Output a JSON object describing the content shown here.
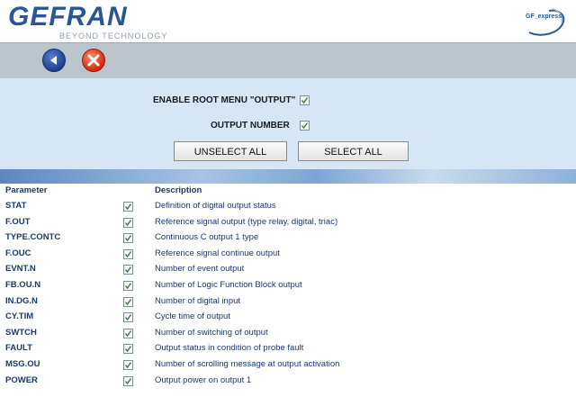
{
  "header": {
    "logo_text": "GEFRAN",
    "tagline": "BEYOND TECHNOLOGY",
    "right_logo_text": "GF_express"
  },
  "toolbar": {
    "back_icon": "back-arrow-icon",
    "close_icon": "close-icon"
  },
  "options": {
    "enable_root_label": "ENABLE ROOT MENU \"OUTPUT\"",
    "enable_root_checked": true,
    "output_number_label": "OUTPUT NUMBER",
    "output_number_checked": true
  },
  "buttons": {
    "unselect_all": "UNSELECT ALL",
    "select_all": "SELECT ALL"
  },
  "table": {
    "headers": {
      "parameter": "Parameter",
      "description": "Description"
    },
    "rows": [
      {
        "param": "STAT",
        "desc": "Definition of digital output status",
        "checked": true
      },
      {
        "param": "F.OUT",
        "desc": "Reference signal output (type relay, digital, triac)",
        "checked": true
      },
      {
        "param": "TYPE.CONTC",
        "desc": "Continuous C output 1 type",
        "checked": true
      },
      {
        "param": "F.OUC",
        "desc": "Reference signal continue output",
        "checked": true
      },
      {
        "param": "EVNT.N",
        "desc": "Number of event output",
        "checked": true
      },
      {
        "param": "FB.OU.N",
        "desc": "Number of Logic Function Block output",
        "checked": true
      },
      {
        "param": "IN.DG.N",
        "desc": "Number of digital input",
        "checked": true
      },
      {
        "param": "CY.TIM",
        "desc": "Cycle time of output",
        "checked": true
      },
      {
        "param": "SWTCH",
        "desc": "Number of switching of output",
        "checked": true
      },
      {
        "param": "FAULT",
        "desc": "Output status in condition of probe fault",
        "checked": true
      },
      {
        "param": "MSG.OU",
        "desc": "Number of scrolling message at output activation",
        "checked": true
      },
      {
        "param": "POWER",
        "desc": "Output power on output 1",
        "checked": true
      }
    ]
  },
  "colors": {
    "brand": "#2a5596",
    "panel_bg": "#d7e6f5",
    "toolbar_bg": "#bcc4cc",
    "text_dark_blue": "#1a3a6a"
  }
}
